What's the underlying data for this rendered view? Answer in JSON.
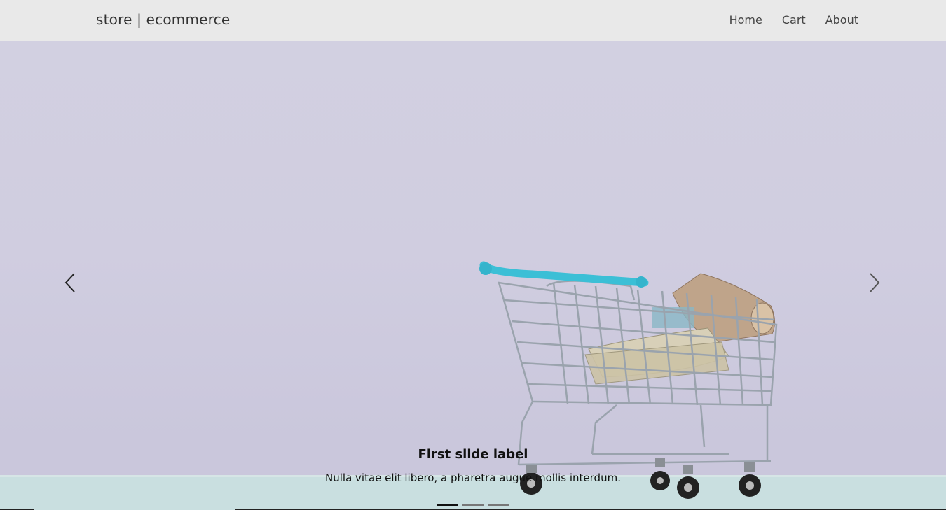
{
  "nav": {
    "brand": "store | ecommerce",
    "links": [
      "Home",
      "Cart",
      "About"
    ]
  },
  "carousel": {
    "active_index": 0,
    "slide_count": 3,
    "caption_title": "First slide label",
    "caption_text": "Nulla vitae elit libero, a pharetra augue mollis interdum.",
    "prev_icon": "chevron-left-icon",
    "next_icon": "chevron-right-icon"
  },
  "colors": {
    "navbar_bg": "#e9e9e9",
    "slide_bg": "#d0cde0",
    "floor": "#c9dfe0",
    "cart_handle": "#3bbfd6",
    "cart_metal": "#9aa3ad"
  }
}
